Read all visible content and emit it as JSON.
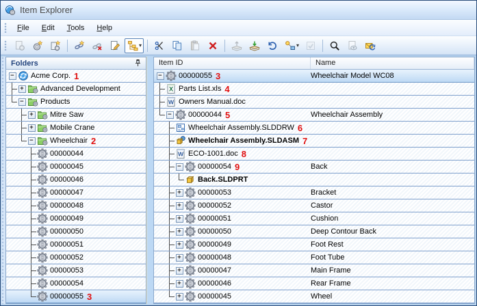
{
  "window": {
    "title": "Item Explorer"
  },
  "menu": {
    "items": [
      {
        "label": "File"
      },
      {
        "label": "Edit"
      },
      {
        "label": "Tools"
      },
      {
        "label": "Help"
      }
    ]
  },
  "toolbar": {
    "items": [
      {
        "name": "view-properties",
        "icon": "doc-gear",
        "disabled": true
      },
      {
        "name": "new-item",
        "icon": "gear-star"
      },
      {
        "name": "save-as-new-item",
        "icon": "doc-gear-star"
      },
      {
        "sep": true
      },
      {
        "name": "create-link",
        "icon": "link-star"
      },
      {
        "name": "remove-link",
        "icon": "link-delete"
      },
      {
        "name": "edit-document",
        "icon": "doc-pencil"
      },
      {
        "name": "tree-display-options",
        "icon": "tree-layout",
        "pressed": true,
        "dropdown": true
      },
      {
        "sep": true
      },
      {
        "name": "cut",
        "icon": "scissors"
      },
      {
        "name": "copy",
        "icon": "copy-pages"
      },
      {
        "name": "paste",
        "icon": "clipboard",
        "disabled": true
      },
      {
        "name": "delete",
        "icon": "red-x"
      },
      {
        "sep": true
      },
      {
        "name": "check-out",
        "icon": "box-out",
        "disabled": true
      },
      {
        "name": "check-in",
        "icon": "box-in"
      },
      {
        "name": "undo-checkout",
        "icon": "undo-arrow"
      },
      {
        "name": "change-state",
        "icon": "workflow",
        "dropdown": true
      },
      {
        "name": "approve",
        "icon": "check-box",
        "disabled": true
      },
      {
        "sep": true
      },
      {
        "name": "search",
        "icon": "magnifier"
      },
      {
        "name": "preview-document",
        "icon": "doc-eye",
        "disabled": true
      },
      {
        "name": "send-notification",
        "icon": "mail-sync"
      }
    ]
  },
  "left_panel": {
    "header": "Folders",
    "rows": [
      {
        "guides": [],
        "j": "exp-",
        "icon": "globe",
        "label": "Acme Corp.",
        "ann": "1"
      },
      {
        "guides": [
          "t"
        ],
        "j": "exp+",
        "icon": "folder",
        "label": "Advanced Development"
      },
      {
        "guides": [
          "l"
        ],
        "j": "exp-",
        "icon": "folder",
        "label": "Products"
      },
      {
        "guides": [
          "e",
          "t"
        ],
        "j": "exp+",
        "icon": "folder",
        "label": "Mitre Saw"
      },
      {
        "guides": [
          "e",
          "t"
        ],
        "j": "exp+",
        "icon": "folder",
        "label": "Mobile Crane"
      },
      {
        "guides": [
          "e",
          "l"
        ],
        "j": "exp-",
        "icon": "folder",
        "label": "Wheelchair",
        "ann": "2"
      },
      {
        "guides": [
          "e",
          "e"
        ],
        "j": "t",
        "icon": "item",
        "label": "00000044"
      },
      {
        "guides": [
          "e",
          "e"
        ],
        "j": "t",
        "icon": "item",
        "label": "00000045"
      },
      {
        "guides": [
          "e",
          "e"
        ],
        "j": "t",
        "icon": "item",
        "label": "00000046"
      },
      {
        "guides": [
          "e",
          "e"
        ],
        "j": "t",
        "icon": "item",
        "label": "00000047"
      },
      {
        "guides": [
          "e",
          "e"
        ],
        "j": "t",
        "icon": "item",
        "label": "00000048"
      },
      {
        "guides": [
          "e",
          "e"
        ],
        "j": "t",
        "icon": "item",
        "label": "00000049"
      },
      {
        "guides": [
          "e",
          "e"
        ],
        "j": "t",
        "icon": "item",
        "label": "00000050"
      },
      {
        "guides": [
          "e",
          "e"
        ],
        "j": "t",
        "icon": "item",
        "label": "00000051"
      },
      {
        "guides": [
          "e",
          "e"
        ],
        "j": "t",
        "icon": "item",
        "label": "00000052"
      },
      {
        "guides": [
          "e",
          "e"
        ],
        "j": "t",
        "icon": "item",
        "label": "00000053"
      },
      {
        "guides": [
          "e",
          "e"
        ],
        "j": "t",
        "icon": "item",
        "label": "00000054"
      },
      {
        "guides": [
          "e",
          "e"
        ],
        "j": "l",
        "icon": "item",
        "label": "00000055",
        "ann": "3",
        "selected": true
      }
    ]
  },
  "right_panel": {
    "columns": [
      "Item ID",
      "Name"
    ],
    "rows": [
      {
        "guides": [],
        "j": "exp-",
        "icon": "item",
        "label": "00000055",
        "ann": "3",
        "name": "Wheelchair Model WC08",
        "selected": true
      },
      {
        "guides": [],
        "j": "t",
        "icon": "excel",
        "label": "Parts List.xls",
        "ann": "4"
      },
      {
        "guides": [],
        "j": "t",
        "icon": "word",
        "label": "Owners Manual.doc"
      },
      {
        "guides": [
          "l"
        ],
        "j": "exp-",
        "icon": "item",
        "label": "00000044",
        "ann": "5",
        "name": "Wheelchair Assembly"
      },
      {
        "guides": [
          "e"
        ],
        "j": "t",
        "icon": "slddrw",
        "label": "Wheelchair Assembly.SLDDRW",
        "ann": "6"
      },
      {
        "guides": [
          "e"
        ],
        "j": "t",
        "icon": "sldasm",
        "label": "Wheelchair Assembly.SLDASM",
        "ann": "7",
        "bold": true
      },
      {
        "guides": [
          "e"
        ],
        "j": "t",
        "icon": "word",
        "label": "ECO-1001.doc",
        "ann": "8"
      },
      {
        "guides": [
          "e",
          "t"
        ],
        "j": "exp-",
        "icon": "item",
        "label": "00000054",
        "ann": "9",
        "name": "Back"
      },
      {
        "guides": [
          "e",
          "v"
        ],
        "j": "l",
        "icon": "sldprt",
        "label": "Back.SLDPRT",
        "bold": true
      },
      {
        "guides": [
          "e",
          "t"
        ],
        "j": "exp+",
        "icon": "item",
        "label": "00000053",
        "name": "Bracket"
      },
      {
        "guides": [
          "e",
          "t"
        ],
        "j": "exp+",
        "icon": "item",
        "label": "00000052",
        "name": "Castor"
      },
      {
        "guides": [
          "e",
          "t"
        ],
        "j": "exp+",
        "icon": "item",
        "label": "00000051",
        "name": "Cushion"
      },
      {
        "guides": [
          "e",
          "t"
        ],
        "j": "exp+",
        "icon": "item",
        "label": "00000050",
        "name": "Deep Contour Back"
      },
      {
        "guides": [
          "e",
          "t"
        ],
        "j": "exp+",
        "icon": "item",
        "label": "00000049",
        "name": "Foot Rest"
      },
      {
        "guides": [
          "e",
          "t"
        ],
        "j": "exp+",
        "icon": "item",
        "label": "00000048",
        "name": "Foot Tube"
      },
      {
        "guides": [
          "e",
          "t"
        ],
        "j": "exp+",
        "icon": "item",
        "label": "00000047",
        "name": "Main Frame"
      },
      {
        "guides": [
          "e",
          "t"
        ],
        "j": "exp+",
        "icon": "item",
        "label": "00000046",
        "name": "Rear Frame"
      },
      {
        "guides": [
          "e",
          "l"
        ],
        "j": "exp+",
        "icon": "item",
        "label": "00000045",
        "name": "Wheel"
      }
    ]
  },
  "colors": {
    "callout": "#e01010",
    "selection_top": "#e8f3fd",
    "selection_bottom": "#bed9f4",
    "row_line": "#7e9fcc",
    "titlebar_text": "#4a4a4a"
  }
}
